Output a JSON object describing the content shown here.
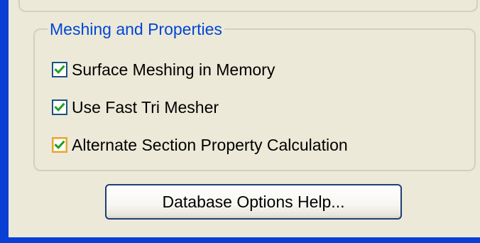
{
  "group": {
    "title": "Meshing and Properties"
  },
  "options": [
    {
      "label": "Surface Meshing in Memory",
      "checked": true
    },
    {
      "label": "Use Fast Tri Mesher",
      "checked": true
    },
    {
      "label": "Alternate Section Property Calculation",
      "checked": true
    }
  ],
  "buttons": {
    "help_label": "Database Options Help..."
  },
  "colors": {
    "window_border": "#0a3fd6",
    "panel_background": "#ece9d8",
    "group_title": "#0046d5",
    "checkmark": "#21a121",
    "focus_highlight": "#e8a33c"
  },
  "icons": {
    "checkmark": "checkmark-icon"
  }
}
